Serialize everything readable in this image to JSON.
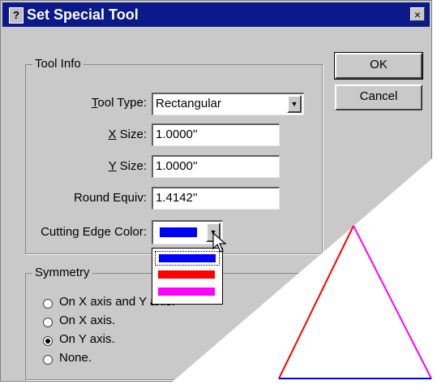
{
  "window": {
    "title": "Set Special Tool",
    "title_icon": "?",
    "close_label": "×"
  },
  "buttons": {
    "ok": "OK",
    "cancel": "Cancel"
  },
  "tool_info": {
    "group_label": "Tool Info",
    "tool_type": {
      "mnemonic": "T",
      "rest": "ool Type:",
      "value": "Rectangular"
    },
    "x_size": {
      "mnemonic": "X",
      "rest": " Size:",
      "value": "1.0000''"
    },
    "y_size": {
      "mnemonic": "Y",
      "rest": " Size:",
      "value": "1.0000''"
    },
    "round_equiv": {
      "label": "Round Equiv:",
      "value": "1.4142''"
    },
    "cutting_edge": {
      "label": "Cutting Edge Color:",
      "selected_color": "#0000ff",
      "options": [
        "#0000ff",
        "#ff0000",
        "#ff00ff"
      ]
    }
  },
  "symmetry": {
    "group_label": "Symmetry",
    "options": [
      {
        "label": "On X axis and Y axis.",
        "checked": false
      },
      {
        "label": "On X axis.",
        "checked": false
      },
      {
        "label": "On Y axis.",
        "checked": true
      },
      {
        "label": "None.",
        "checked": false
      }
    ]
  },
  "preview": {
    "triangle_left_color": "#ff0000",
    "triangle_right_color": "#ff00ff",
    "triangle_base_color": "#0000ff"
  },
  "icons": {
    "dropdown_arrow": "▼"
  }
}
